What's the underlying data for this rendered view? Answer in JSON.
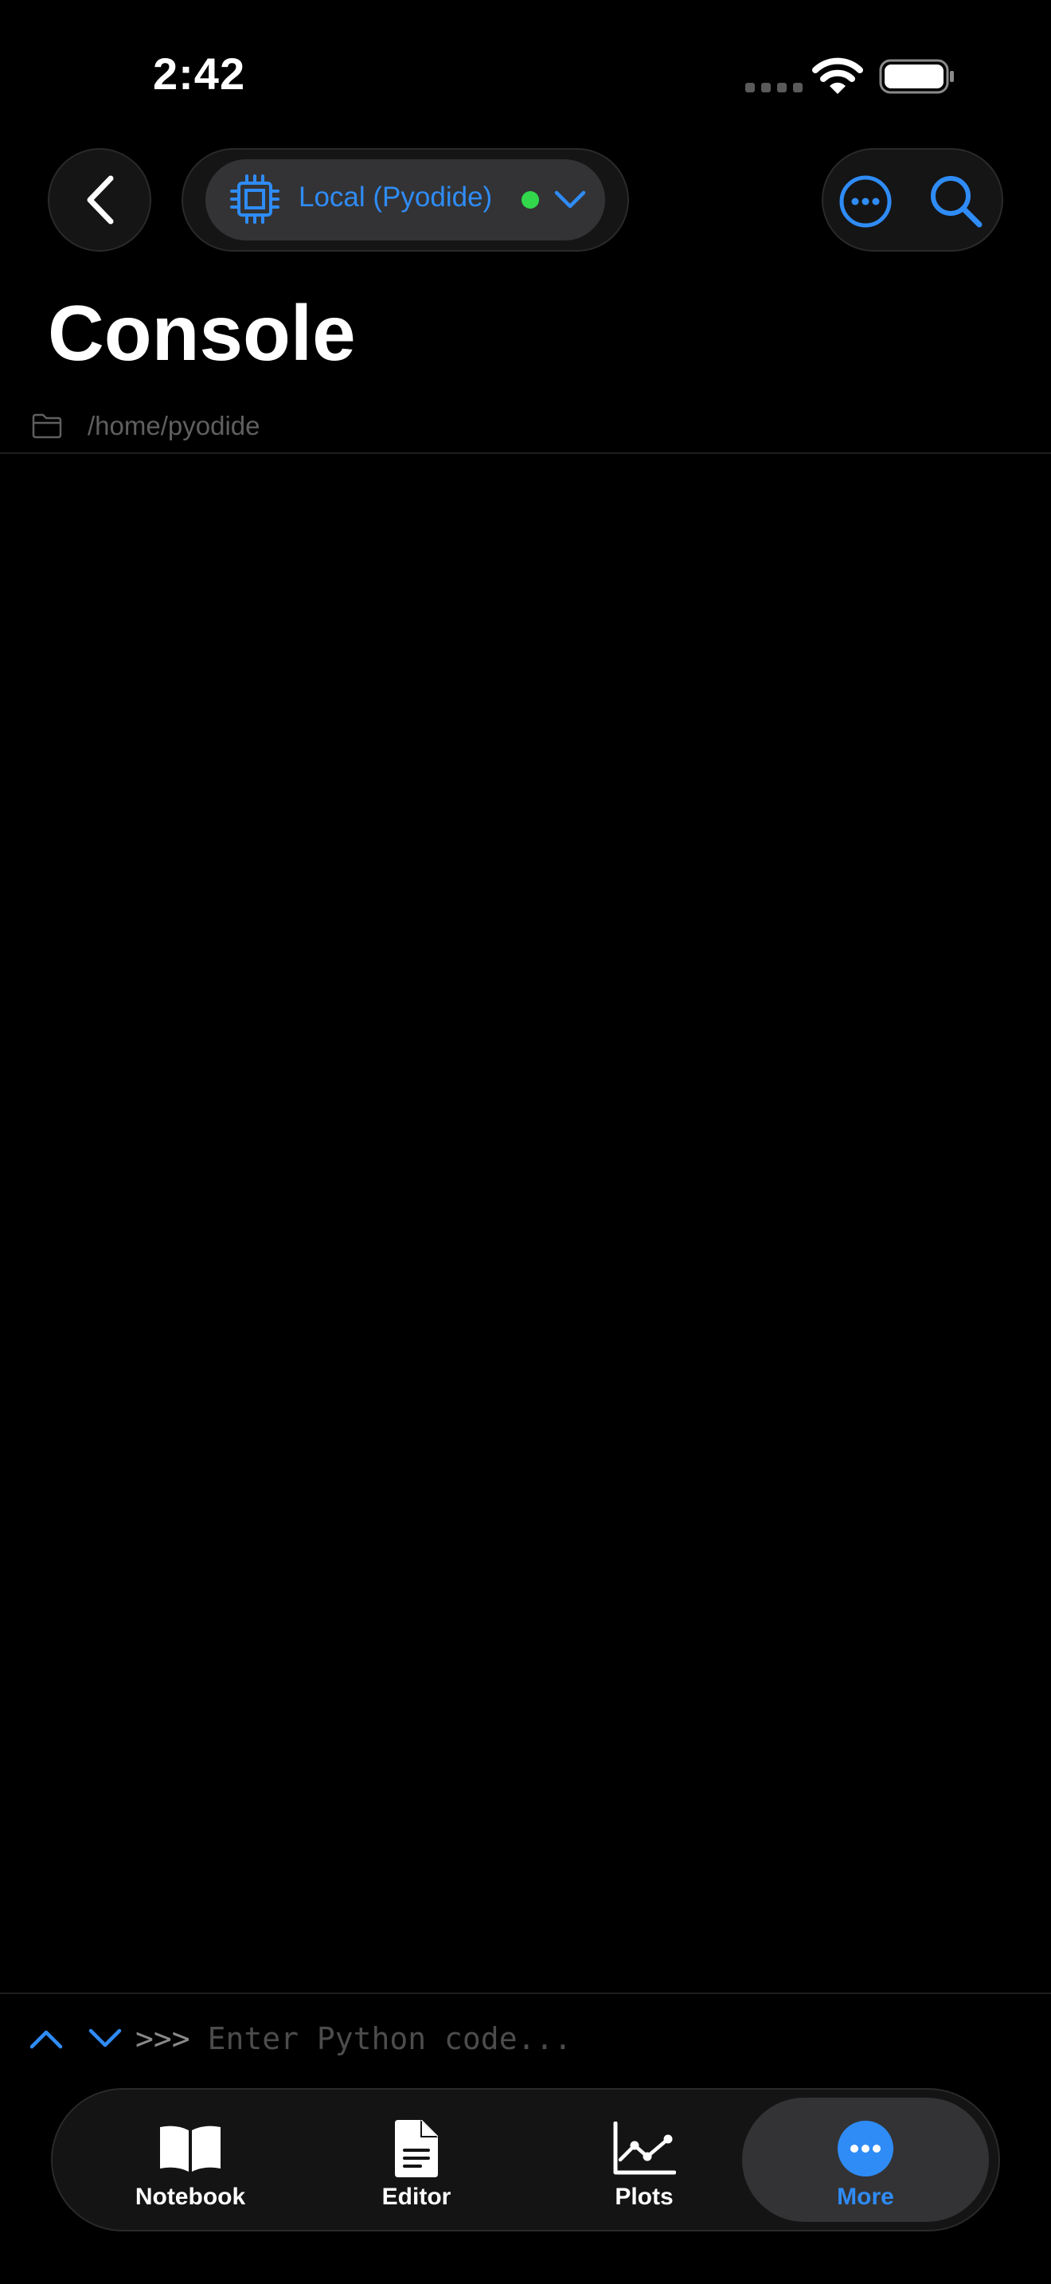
{
  "status_bar": {
    "time": "2:42"
  },
  "nav": {
    "kernel_label": "Local (Pyodide)",
    "kernel_status_color": "#32d74b"
  },
  "page": {
    "title": "Console",
    "path": "/home/pyodide"
  },
  "console": {
    "prompt": ">>>",
    "placeholder": "Enter Python code..."
  },
  "tab_bar": {
    "tabs": [
      {
        "label": "Notebook",
        "icon": "book-icon",
        "active": false
      },
      {
        "label": "Editor",
        "icon": "document-icon",
        "active": false
      },
      {
        "label": "Plots",
        "icon": "chart-icon",
        "active": false
      },
      {
        "label": "More",
        "icon": "more-icon",
        "active": true
      }
    ]
  },
  "colors": {
    "accent": "#2f8cf6",
    "background": "#000000",
    "status_ok": "#32d74b"
  }
}
